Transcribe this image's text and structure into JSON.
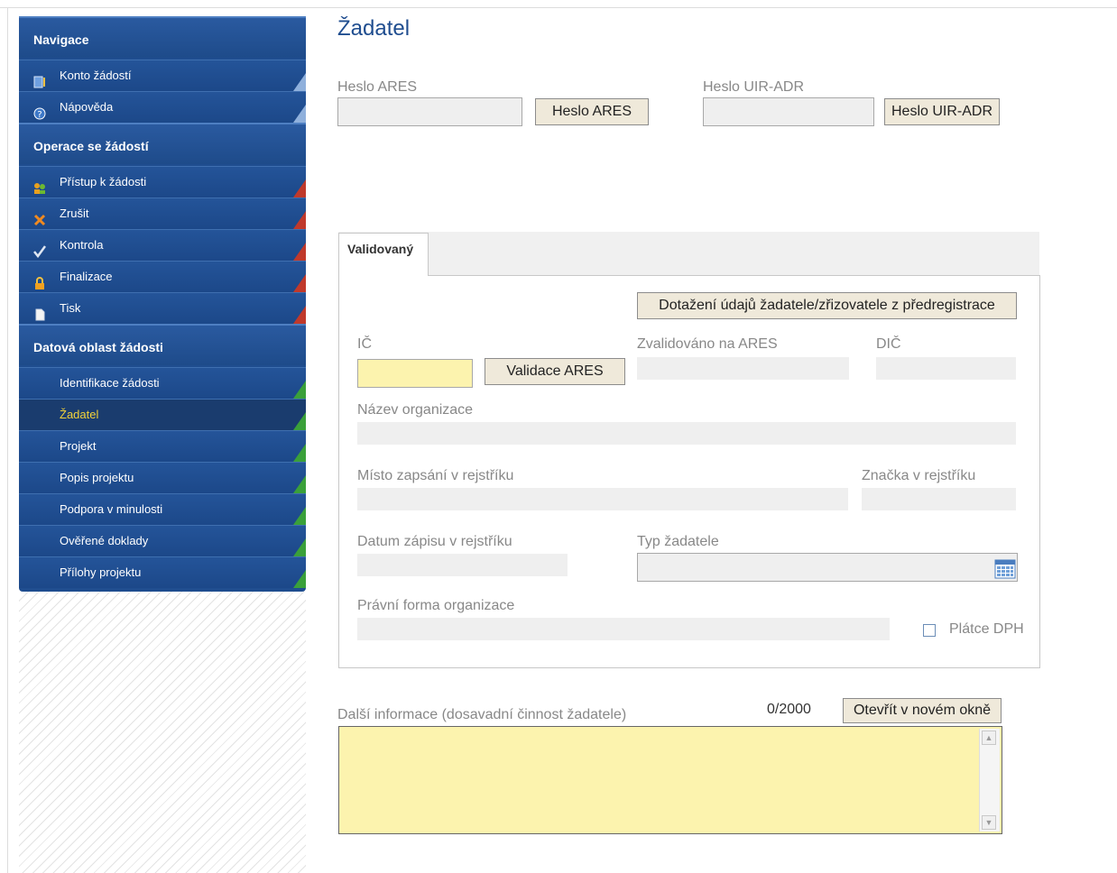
{
  "sidebar": {
    "sections": [
      {
        "title": "Navigace"
      },
      {
        "title": "Operace se žádostí"
      },
      {
        "title": "Datová oblast žádosti"
      }
    ],
    "nav_items": [
      {
        "label": "Konto žádostí",
        "icon": "notebook-icon"
      },
      {
        "label": "Nápověda",
        "icon": "help-icon"
      }
    ],
    "operation_items": [
      {
        "label": "Přístup k žádosti",
        "icon": "users-icon"
      },
      {
        "label": "Zrušit",
        "icon": "cross-icon"
      },
      {
        "label": "Kontrola",
        "icon": "check-icon"
      },
      {
        "label": "Finalizace",
        "icon": "lock-icon"
      },
      {
        "label": "Tisk",
        "icon": "document-icon"
      }
    ],
    "data_items": [
      {
        "label": "Identifikace žádosti"
      },
      {
        "label": "Žadatel",
        "active": true
      },
      {
        "label": "Projekt"
      },
      {
        "label": "Popis projektu"
      },
      {
        "label": "Podpora v minulosti"
      },
      {
        "label": "Ověřené doklady"
      },
      {
        "label": "Přílohy projektu"
      }
    ]
  },
  "page": {
    "title": "Žadatel",
    "heslo_ares_label": "Heslo ARES",
    "heslo_ares_button": "Heslo ARES",
    "heslo_uir_label": "Heslo UIR-ADR",
    "heslo_uir_button": "Heslo UIR-ADR"
  },
  "tab": {
    "label": "Validovaný"
  },
  "form": {
    "dotazeni_button": "Dotažení údajů žadatele/zřizovatele z předregistrace",
    "ic_label": "IČ",
    "validace_button": "Validace ARES",
    "zvalidovano_label": "Zvalidováno na ARES",
    "dic_label": "DIČ",
    "nazev_label": "Název organizace",
    "misto_label": "Místo zapsání v rejstříku",
    "znacka_label": "Značka v rejstříku",
    "datum_label": "Datum zápisu v rejstříku",
    "typ_label": "Typ žadatele",
    "pravni_label": "Právní forma organizace",
    "platce_label": "Plátce DPH"
  },
  "dalsi": {
    "label": "Další informace (dosavadní činnost žadatele)",
    "counter": "0/2000",
    "open_button": "Otevřít v novém okně"
  },
  "colors": {
    "sidebar_bg": "#1f4d8f",
    "active_text": "#f2d23a",
    "required_field": "#fcf3ae",
    "title": "#1f4d8f"
  }
}
